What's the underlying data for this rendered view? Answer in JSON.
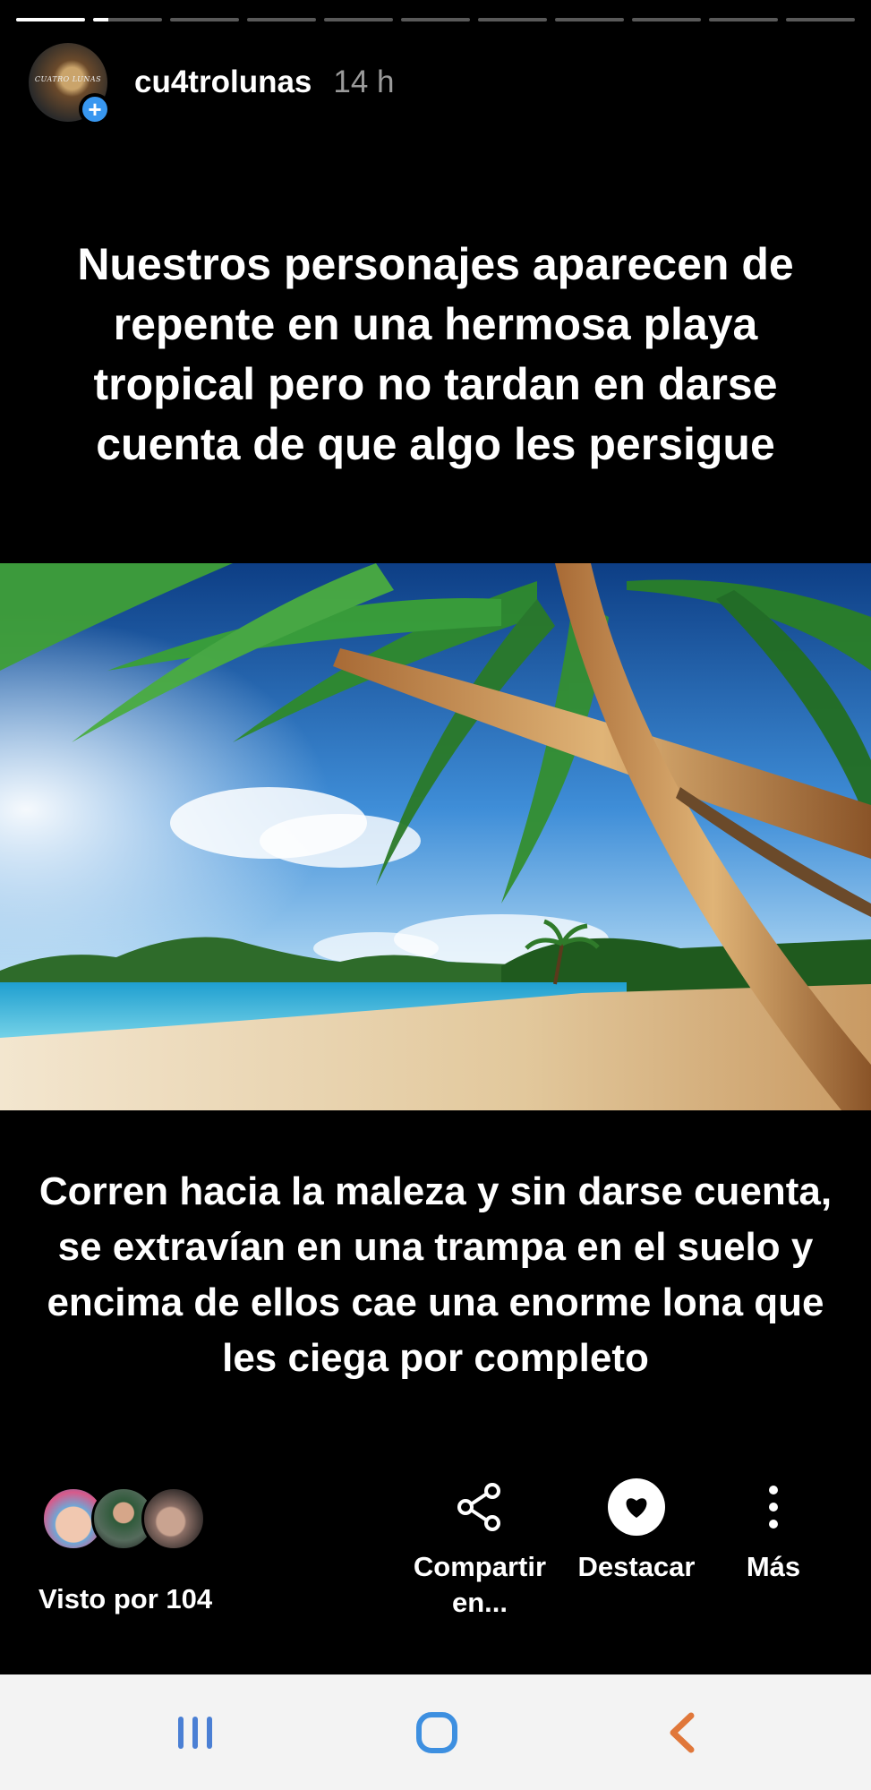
{
  "story": {
    "segments_total": 11,
    "active_segment": 2,
    "active_progress": 0.22
  },
  "header": {
    "avatar_text": "CUATRO LUNAS",
    "username": "cu4trolunas",
    "time": "14 h"
  },
  "captions": {
    "top": "Nuestros personajes aparecen de repente en una hermosa playa tropical pero no tardan en darse cuenta de que algo les persigue",
    "bottom": "Corren hacia la maleza y sin darse cuenta, se extravían en una trampa en el suelo y encima de ellos cae una enorme lona que les ciega por completo"
  },
  "viewers": {
    "label": "Visto por 104"
  },
  "actions": {
    "share_label": "Compartir en...",
    "highlight_label": "Destacar",
    "more_label": "Más"
  },
  "navbar": {
    "recent_icon": "recent-apps-icon",
    "home_icon": "home-icon",
    "back_icon": "back-icon"
  },
  "colors": {
    "accent": "#3897f0",
    "nav_recent": "#4a7fd4",
    "nav_home": "#3d8fe0",
    "nav_back": "#e0773a"
  }
}
